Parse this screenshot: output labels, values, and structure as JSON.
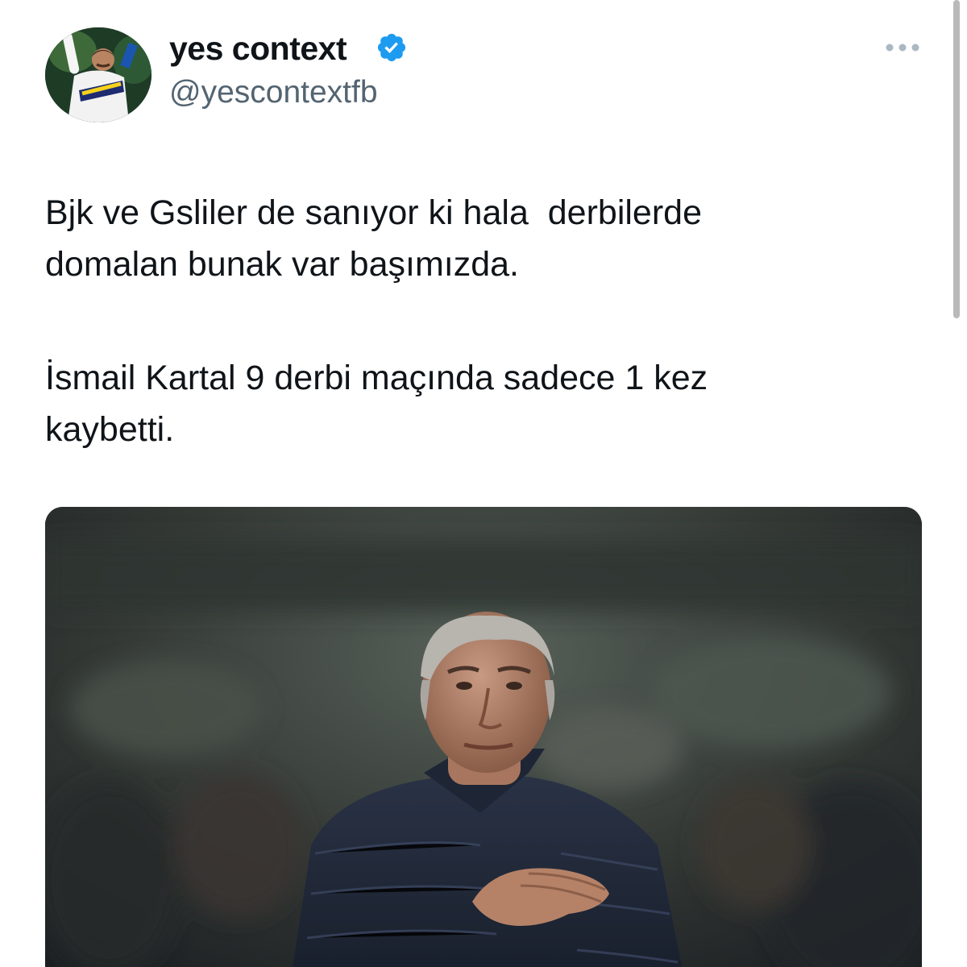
{
  "author": {
    "display_name": "yes context",
    "handle": "@yescontextfb",
    "verified": true,
    "avatar_icon": "profile-photo"
  },
  "tweet": {
    "paragraph_1": "Bjk ve Gsliler de sanıyor ki hala  derbilerde\ndomalan bunak var başımızda.",
    "paragraph_2": "İsmail Kartal 9 derbi maçında sadece 1 kez\nkaybetti."
  },
  "media": {
    "type": "photo"
  },
  "icons": {
    "verified": "verified-badge-icon",
    "more": "more-horizontal-icon"
  },
  "colors": {
    "verified_blue": "#1d9bf0",
    "text_primary": "#0f1419",
    "text_secondary": "#536471",
    "more_icon": "#aab8c2"
  }
}
